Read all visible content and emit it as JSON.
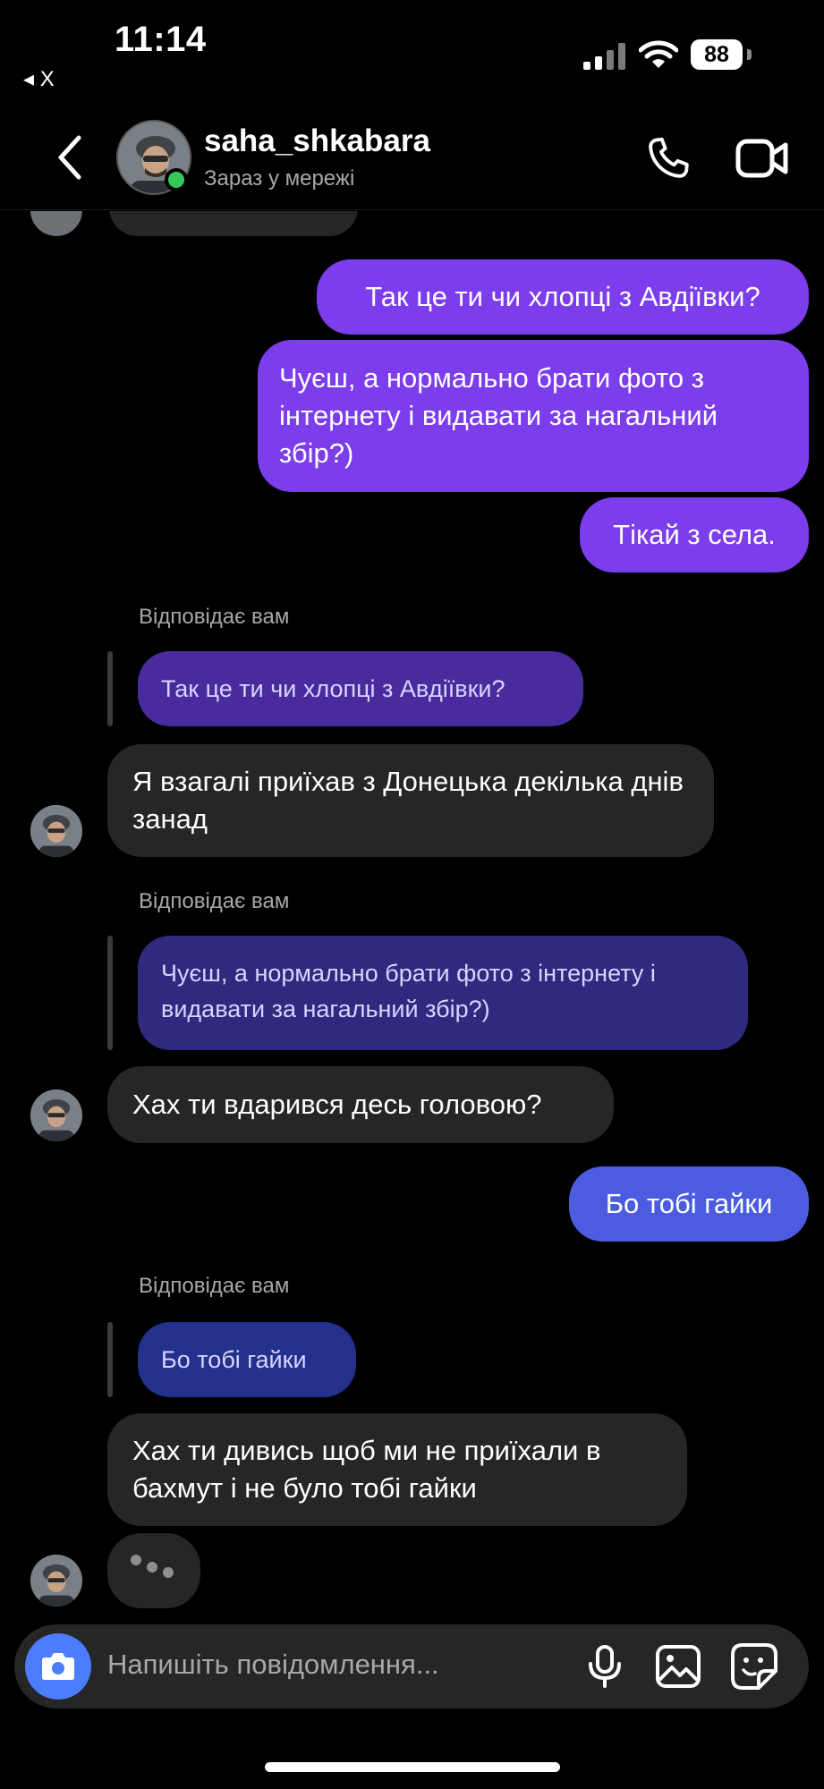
{
  "status_bar": {
    "time": "11:14",
    "back_app": "◂ X",
    "battery": "88"
  },
  "header": {
    "username": "saha_shkabara",
    "status": "Зараз у мережі"
  },
  "messages": {
    "m1": "Так це ти чи хлопці з Авдіївки?",
    "m2": "Чуєш, а нормально брати фото з інтернету і видавати за нагальний збір?)",
    "m3": "Тікай з села.",
    "reply_label": "Відповідає вам",
    "q1": "Так це ти чи хлопці з Авдіївки?",
    "r1": "Я взагалі приїхав з Донецька декілька днів занад",
    "q2": "Чуєш, а нормально брати фото з інтернету і видавати за нагальний збір?)",
    "r2": "Хах ти вдарився десь головою?",
    "m4": "Бо тобі гайки",
    "q3": "Бо тобі гайки",
    "r3": "Хах ти дивись щоб ми не приїхали в бахмут і не було тобі гайки"
  },
  "composer": {
    "placeholder": "Напишіть повідомлення..."
  },
  "colors": {
    "sent": "#7c3ded",
    "sent_latest": "#4c5ce0",
    "received": "#262626",
    "online": "#35c759",
    "camera_button": "#4d7dff"
  }
}
